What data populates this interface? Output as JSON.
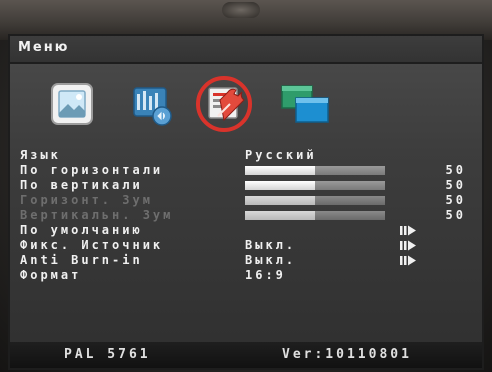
{
  "window": {
    "title": "Меню"
  },
  "tabs": [
    {
      "icon": "picture-icon"
    },
    {
      "icon": "audio-icon"
    },
    {
      "icon": "tools-icon",
      "selected": true
    },
    {
      "icon": "windows-icon"
    }
  ],
  "menu": {
    "items": [
      {
        "label": "Язык",
        "value": "Русский",
        "type": "text"
      },
      {
        "label": "По горизонтали",
        "value": "50",
        "level": 0.5,
        "type": "slider"
      },
      {
        "label": "По вертикали",
        "value": "50",
        "level": 0.5,
        "type": "slider"
      },
      {
        "label": "Горизонт. Зум",
        "value": "50",
        "level": 0.5,
        "type": "slider",
        "disabled": true
      },
      {
        "label": "Вертикальн. Зум",
        "value": "50",
        "level": 0.5,
        "type": "slider",
        "disabled": true
      },
      {
        "label": "По умолчанию",
        "type": "action"
      },
      {
        "label": "Фикс. Источник",
        "value": "Выкл.",
        "type": "action"
      },
      {
        "label": "Anti Burn-in",
        "value": "Выкл.",
        "type": "action"
      },
      {
        "label": "Формат",
        "value": "16:9",
        "type": "text"
      }
    ]
  },
  "status": {
    "signal": "PAL 5761",
    "version": "Ver:10110801"
  },
  "colors": {
    "selected_ring": "#d9332b",
    "text": "#f0f0f0",
    "disabled_text": "#6e6e6e"
  }
}
